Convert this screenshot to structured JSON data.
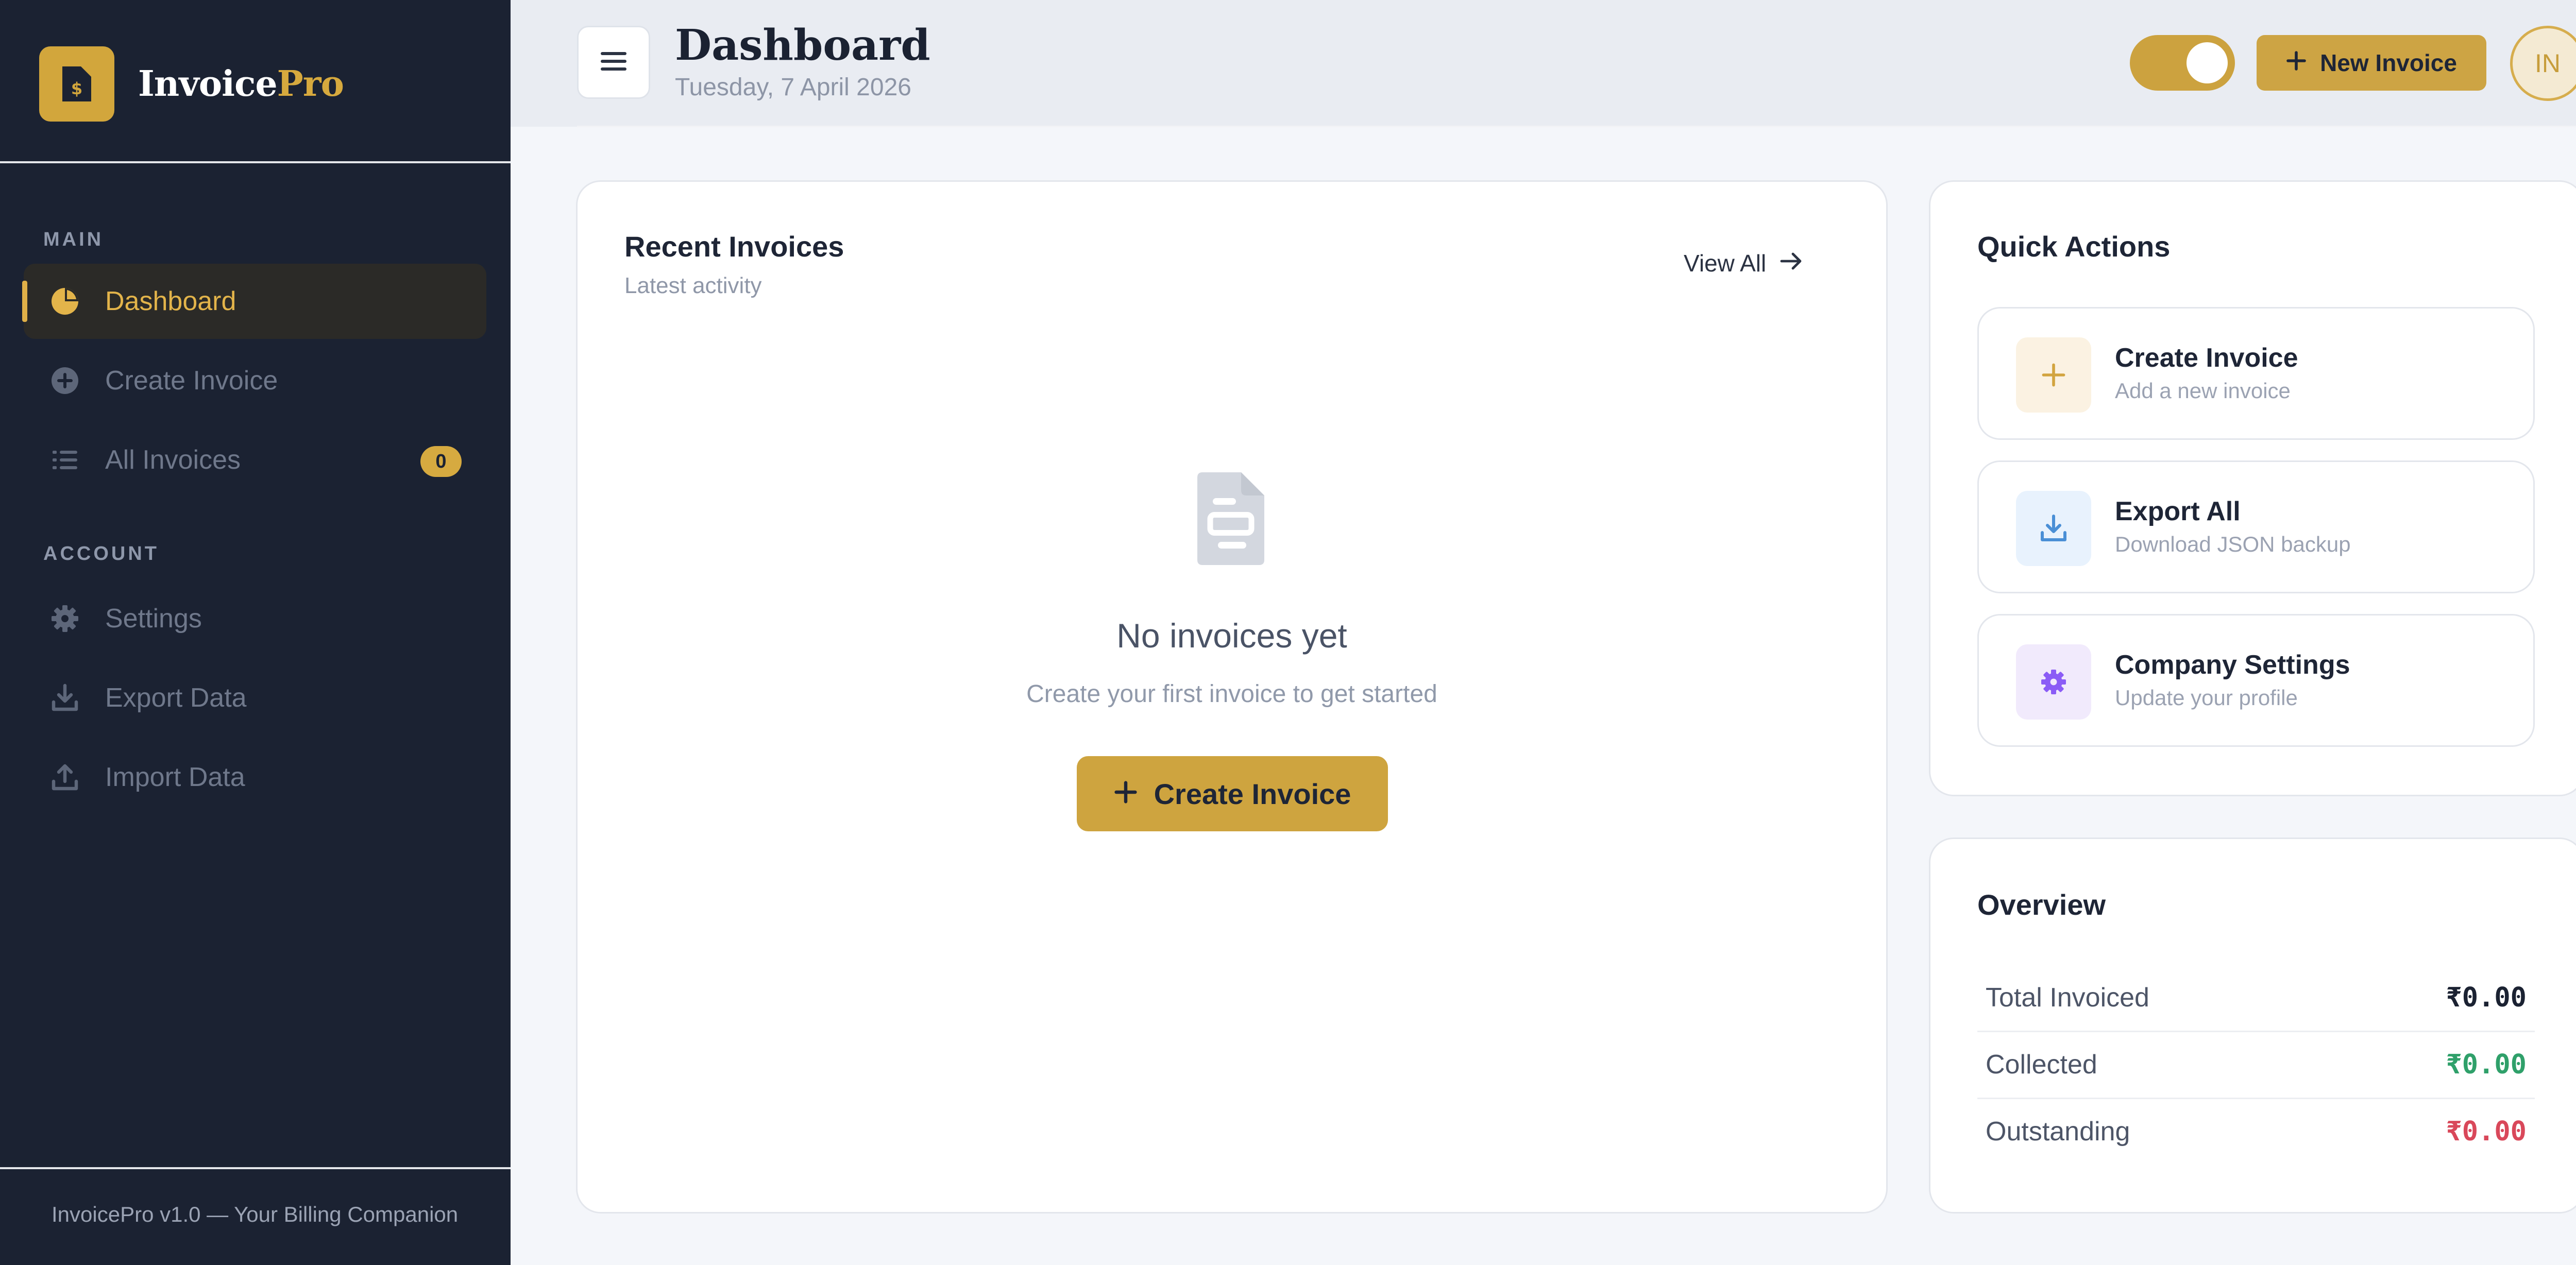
{
  "brand": {
    "name_main": "Invoice",
    "name_accent": "Pro",
    "logo_icon": "invoice-file-icon"
  },
  "sidebar": {
    "sections": [
      {
        "label": "MAIN",
        "items": [
          {
            "label": "Dashboard",
            "icon": "pie-chart-icon",
            "active": true
          },
          {
            "label": "Create Invoice",
            "icon": "plus-circle-icon",
            "active": false
          },
          {
            "label": "All Invoices",
            "icon": "list-icon",
            "active": false,
            "badge": "0"
          }
        ]
      },
      {
        "label": "ACCOUNT",
        "items": [
          {
            "label": "Settings",
            "icon": "gear-icon"
          },
          {
            "label": "Export Data",
            "icon": "download-icon"
          },
          {
            "label": "Import Data",
            "icon": "upload-icon"
          }
        ]
      }
    ],
    "footer": "InvoicePro v1.0 — Your Billing Companion"
  },
  "header": {
    "title": "Dashboard",
    "date": "Tuesday, 7 April 2026",
    "new_invoice_label": "New Invoice",
    "avatar_initials": "IN"
  },
  "recent_invoices": {
    "title": "Recent Invoices",
    "subtitle": "Latest activity",
    "view_all_label": "View All",
    "empty_title": "No invoices yet",
    "empty_subtitle": "Create your first invoice to get started",
    "create_label": "Create Invoice"
  },
  "quick_actions": {
    "title": "Quick Actions",
    "items": [
      {
        "title": "Create Invoice",
        "subtitle": "Add a new invoice",
        "icon": "plus-icon"
      },
      {
        "title": "Export All",
        "subtitle": "Download JSON backup",
        "icon": "download-icon"
      },
      {
        "title": "Company Settings",
        "subtitle": "Update your profile",
        "icon": "gear-icon"
      }
    ]
  },
  "overview": {
    "title": "Overview",
    "rows": [
      {
        "label": "Total Invoiced",
        "value": "₹0.00",
        "color": "#1b2232"
      },
      {
        "label": "Collected",
        "value": "₹0.00",
        "color": "#2fa06a"
      },
      {
        "label": "Outstanding",
        "value": "₹0.00",
        "color": "#d9485a"
      }
    ]
  },
  "colors": {
    "sidebar_bg": "#1b2232",
    "accent_gold": "#cea43f",
    "collected_green": "#2fa06a",
    "outstanding_red": "#d9485a"
  }
}
